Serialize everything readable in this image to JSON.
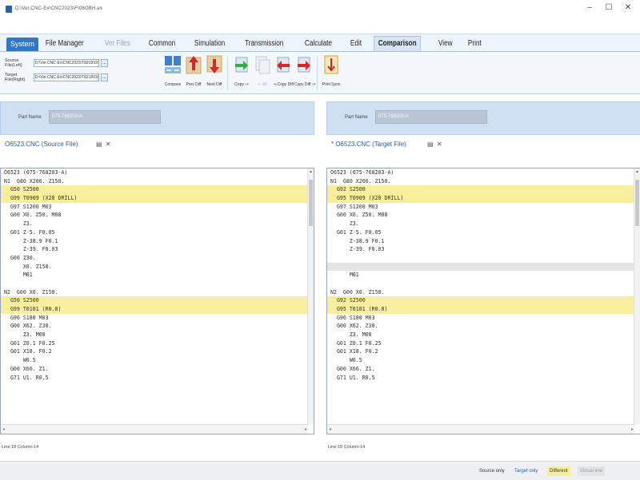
{
  "window": {
    "title": "D:\\Ver.CNC-Ex\\CNC2023\\F\\08OBH.ex",
    "controls": [
      "–",
      "☐",
      "✕"
    ]
  },
  "menu": {
    "tabs": [
      {
        "label": "System",
        "state": "system"
      },
      {
        "label": "File Manager",
        "state": "normal"
      },
      {
        "label": "Ver Files",
        "state": "disabled"
      },
      {
        "label": "Common",
        "state": "normal"
      },
      {
        "label": "Simulation",
        "state": "normal"
      },
      {
        "label": "Transmission",
        "state": "normal"
      },
      {
        "label": "Calculate",
        "state": "normal"
      },
      {
        "label": "Edit",
        "state": "normal"
      },
      {
        "label": "Comparison",
        "state": "active"
      },
      {
        "label": "View",
        "state": "normal"
      },
      {
        "label": "Print",
        "state": "normal"
      }
    ]
  },
  "ribbon": {
    "source_label": "Source File(Left)",
    "source_path": "D:\\Ver.CNC-Ex\\CNC2023\\T8219\\O0652",
    "target_label": "Target File(Right)",
    "target_path": "D:\\Ver.CNC-Ex\\CNC2023\\T8219\\O0653",
    "browse": "...",
    "buttons": {
      "compare": "Compare",
      "prev_diff": "Prev Diff",
      "next_diff": "Next Diff",
      "copy": "Copy ->",
      "copy_all": "<- All",
      "copy_diff_left": "<-Copy Diff",
      "copy_diff_right": "Copy Diff ->",
      "print_sync": "Print Sync"
    }
  },
  "left_panel": {
    "part_label": "Part Name",
    "part_value": "075-768203-A",
    "doc_title": "O6523.CNC (Source File)",
    "cursor_info": "Line:18  Column:14",
    "lines": [
      {
        "text": "O6523 (075-768203-A)",
        "hl": "none"
      },
      {
        "text": "N1  G80 X200. Z150.",
        "hl": "none"
      },
      {
        "text": "  G50 S2500",
        "hl": "diff"
      },
      {
        "text": "  G99 T0909 (X20 DRILL)",
        "hl": "diff"
      },
      {
        "text": "  G97 S1200 M03",
        "hl": "none"
      },
      {
        "text": "  G00 X0. Z50. M08",
        "hl": "none"
      },
      {
        "text": "      Z3.",
        "hl": "none"
      },
      {
        "text": "  G01 Z-5. F0.05",
        "hl": "none"
      },
      {
        "text": "      Z-38.9 F0.1",
        "hl": "none"
      },
      {
        "text": "      Z-39. F0.03",
        "hl": "none"
      },
      {
        "text": "  G00 Z30.",
        "hl": "none"
      },
      {
        "text": "      X0. Z150.",
        "hl": "none"
      },
      {
        "text": "      M01",
        "hl": "none"
      },
      {
        "text": "",
        "hl": "none"
      },
      {
        "text": "N2  G00 X0. Z150.",
        "hl": "none"
      },
      {
        "text": "  G50 S2500",
        "hl": "diff"
      },
      {
        "text": "  G99 T0101 (R0.8)",
        "hl": "diff"
      },
      {
        "text": "  G96 S180 M03",
        "hl": "none"
      },
      {
        "text": "  G00 X62. Z30.",
        "hl": "none"
      },
      {
        "text": "      Z3. M08",
        "hl": "none"
      },
      {
        "text": "  G01 Z0.1 F0.25",
        "hl": "none"
      },
      {
        "text": "  G01 X18. F0.2",
        "hl": "none"
      },
      {
        "text": "      W0.5",
        "hl": "none"
      },
      {
        "text": "  G00 X66. Z1.",
        "hl": "none"
      },
      {
        "text": "  G71 U1. R0.5",
        "hl": "none"
      }
    ]
  },
  "right_panel": {
    "part_label": "Part Name",
    "part_value": "075-768203-A",
    "doc_title": "* O6523.CNC (Target File)",
    "cursor_info": "Line:18  Column:14",
    "lines": [
      {
        "text": "O6523 (075-768203-A)",
        "hl": "none"
      },
      {
        "text": "N1  G80 X200. Z150.",
        "hl": "none"
      },
      {
        "text": "  G92 S2500",
        "hl": "diff"
      },
      {
        "text": "  G95 T0909 (X20 DRILL)",
        "hl": "diff"
      },
      {
        "text": "  G97 S1200 M03",
        "hl": "none"
      },
      {
        "text": "  G00 X0. Z50. M08",
        "hl": "none"
      },
      {
        "text": "      Z3.",
        "hl": "none"
      },
      {
        "text": "  G01 Z-5. F0.05",
        "hl": "none"
      },
      {
        "text": "      Z-38.9 F0.1",
        "hl": "none"
      },
      {
        "text": "      Z-39. F0.03",
        "hl": "none"
      },
      {
        "text": "",
        "hl": "none"
      },
      {
        "text": "",
        "hl": "gap"
      },
      {
        "text": "      M01",
        "hl": "none"
      },
      {
        "text": "",
        "hl": "none"
      },
      {
        "text": "N2  G00 X0. Z150.",
        "hl": "none"
      },
      {
        "text": "  G92 S2500",
        "hl": "diff"
      },
      {
        "text": "  G95 T0101 (R0.8)",
        "hl": "diff"
      },
      {
        "text": "  G96 S180 M03",
        "hl": "none"
      },
      {
        "text": "  G00 X62. Z30.",
        "hl": "none"
      },
      {
        "text": "      Z3. M08",
        "hl": "none"
      },
      {
        "text": "  G01 Z0.1 F0.25",
        "hl": "none"
      },
      {
        "text": "  G01 X18. F0.2",
        "hl": "none"
      },
      {
        "text": "      W0.5",
        "hl": "none"
      },
      {
        "text": "  G00 X66. Z1.",
        "hl": "none"
      },
      {
        "text": "  G71 U1. R0.5",
        "hl": "none"
      }
    ]
  },
  "legend": {
    "source_only": "Source only",
    "target_only": "Target only",
    "different": "Different",
    "virtual_line": "Virtual line"
  },
  "colors": {
    "diff_highlight": "#f7ef9e",
    "gap_line": "#e4e4e4",
    "accent": "#2f78c8",
    "panel_header": "#cfe0f3"
  }
}
